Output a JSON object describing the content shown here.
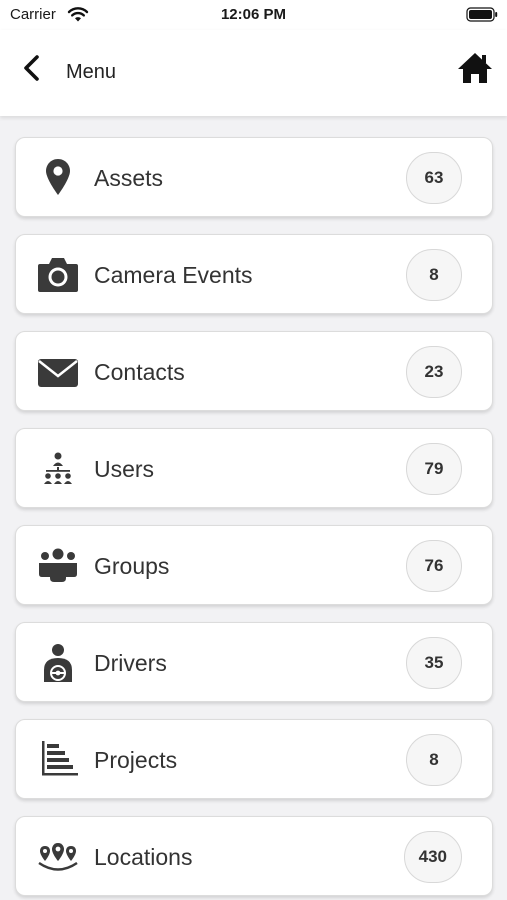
{
  "status_bar": {
    "carrier": "Carrier",
    "time": "12:06 PM"
  },
  "header": {
    "title": "Menu",
    "back_icon": "chevron-left-icon",
    "home_icon": "home-icon"
  },
  "menu": {
    "items": [
      {
        "label": "Assets",
        "count": "63",
        "icon": "map-marker-icon"
      },
      {
        "label": "Camera Events",
        "count": "8",
        "icon": "camera-icon"
      },
      {
        "label": "Contacts",
        "count": "23",
        "icon": "envelope-icon"
      },
      {
        "label": "Users",
        "count": "79",
        "icon": "users-hierarchy-icon"
      },
      {
        "label": "Groups",
        "count": "76",
        "icon": "group-icon"
      },
      {
        "label": "Drivers",
        "count": "35",
        "icon": "driver-icon"
      },
      {
        "label": "Projects",
        "count": "8",
        "icon": "gantt-chart-icon"
      },
      {
        "label": "Locations",
        "count": "430",
        "icon": "locations-icon"
      }
    ]
  },
  "colors": {
    "icon": "#3a3a3a",
    "background": "#f2f2f4",
    "card": "#ffffff",
    "badge": "#f6f6f6"
  }
}
